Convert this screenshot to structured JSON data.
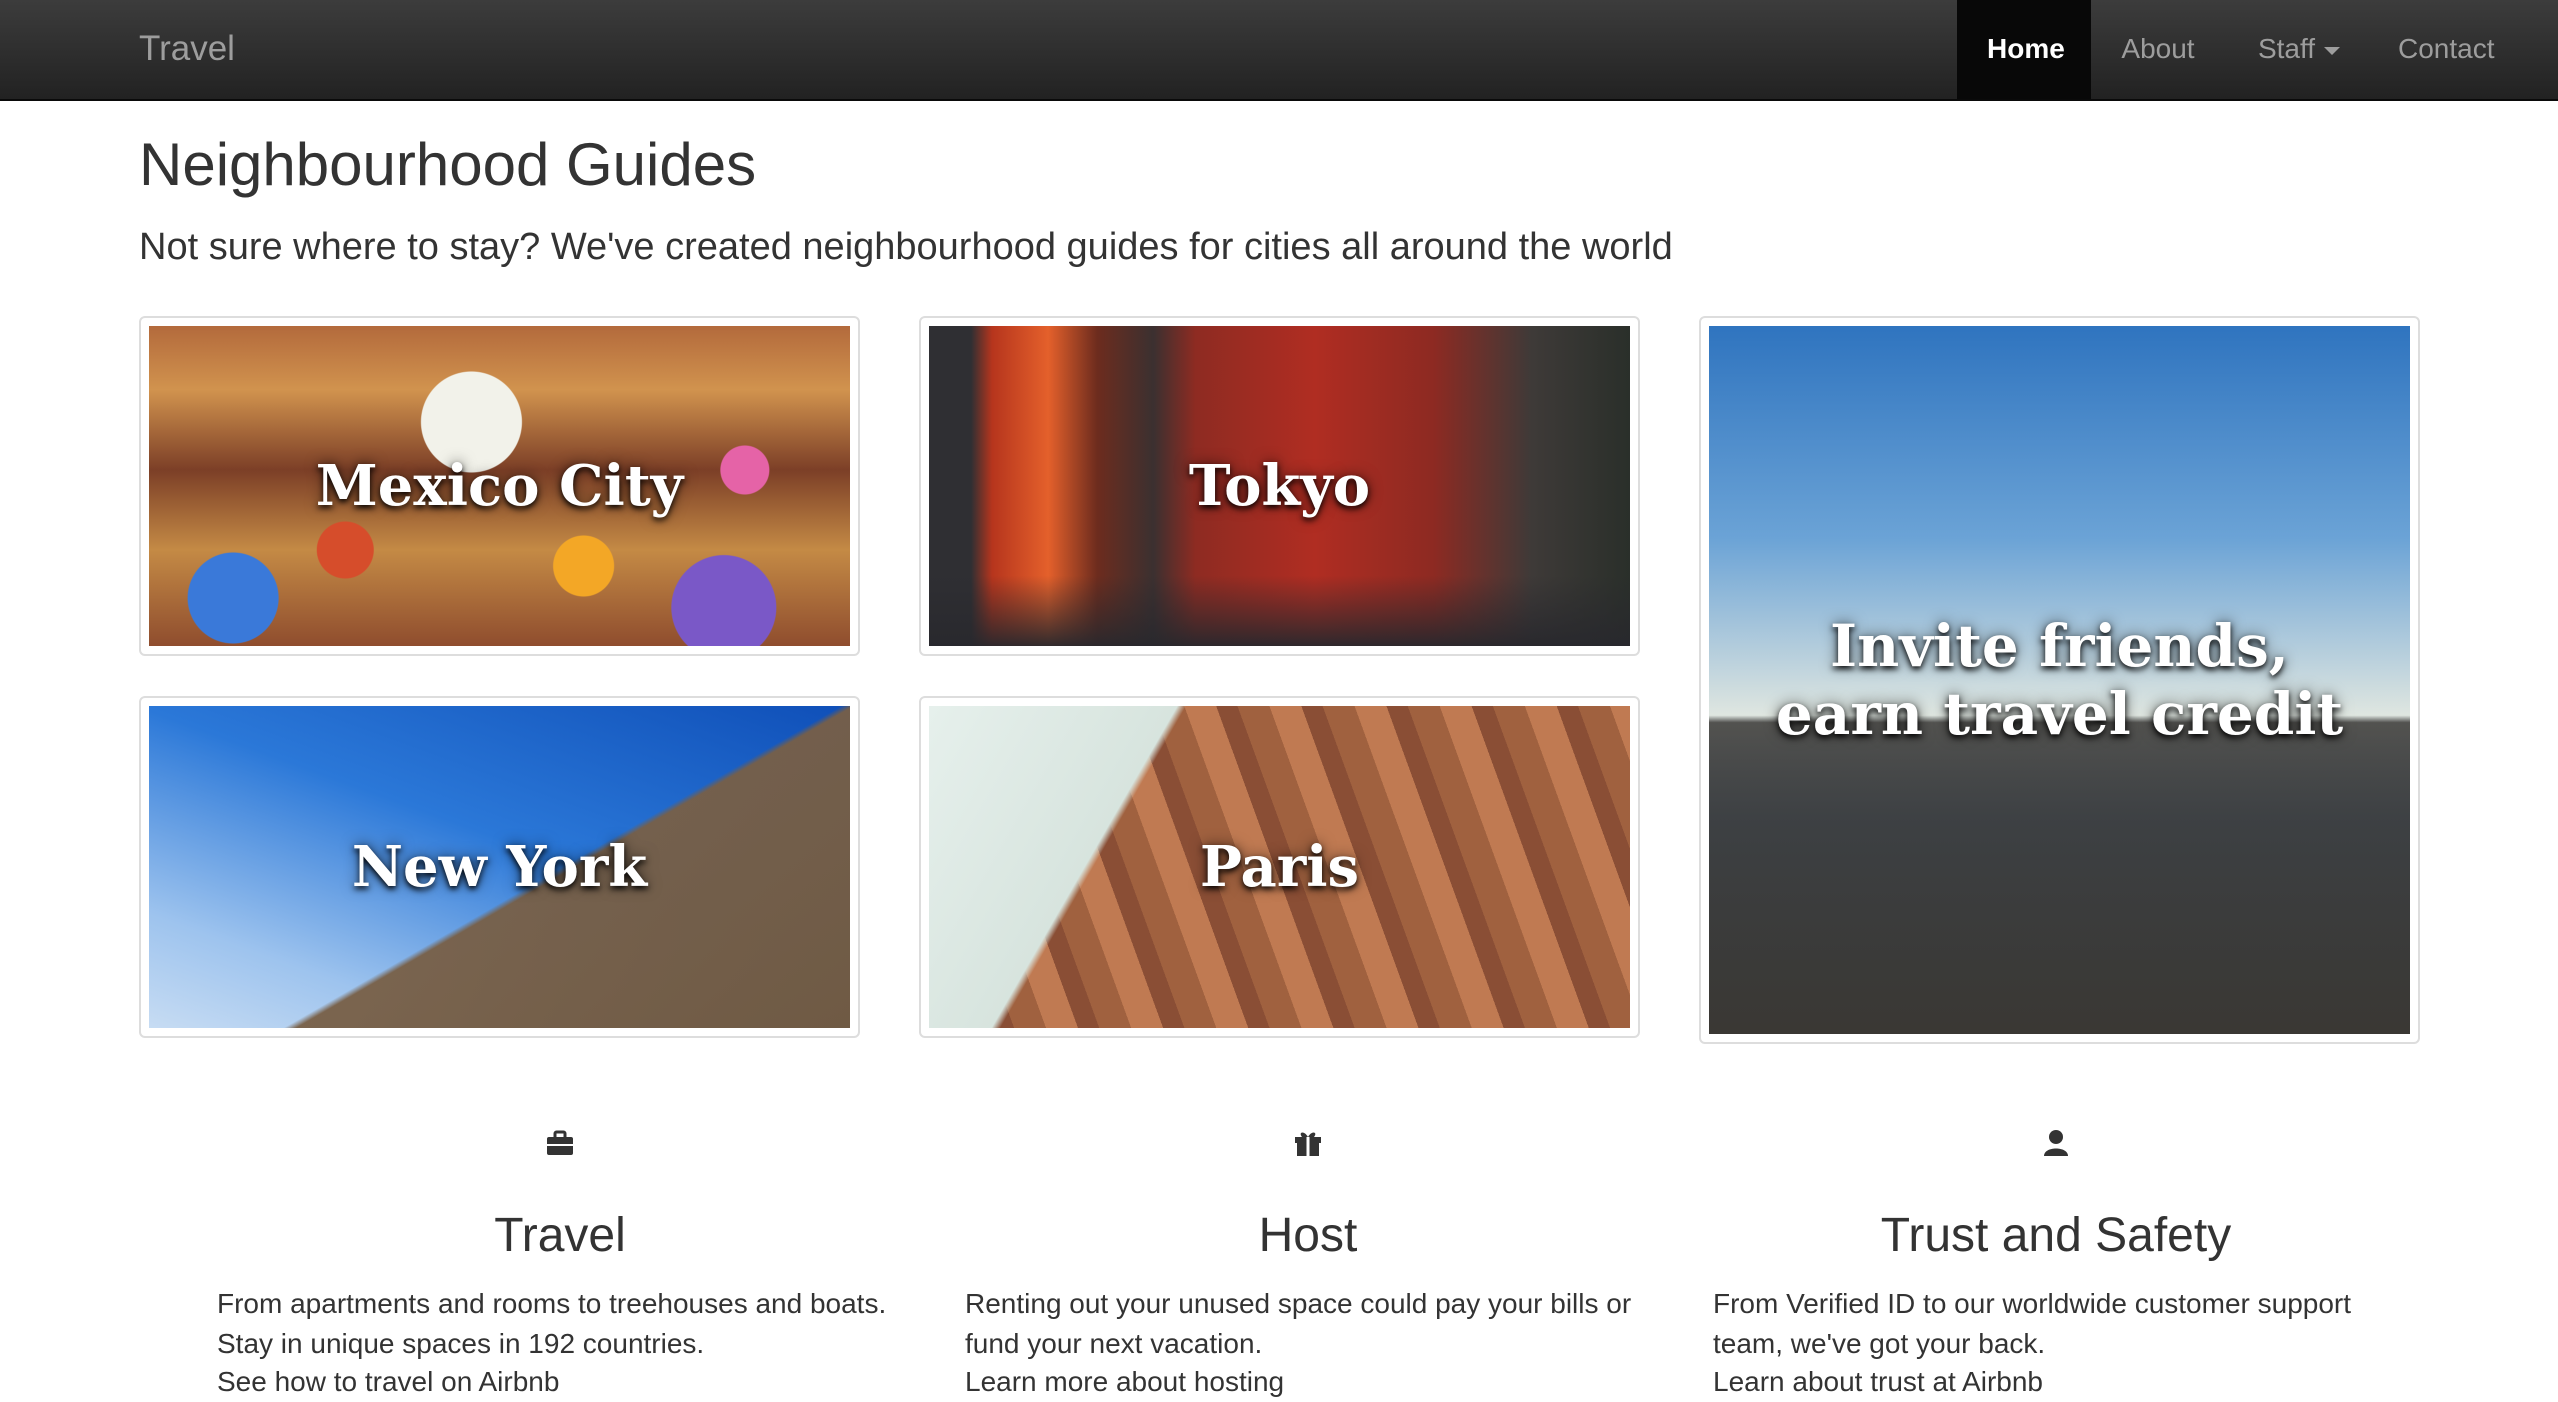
{
  "navbar": {
    "brand": "Travel",
    "items": [
      {
        "label": "Home"
      },
      {
        "label": "About"
      },
      {
        "label": "Staff"
      },
      {
        "label": "Contact"
      }
    ]
  },
  "header": {
    "title": "Neighbourhood Guides",
    "lead": "Not sure where to stay? We've created neighbourhood guides for cities all around the world"
  },
  "guides": [
    {
      "caption": "Mexico City"
    },
    {
      "caption": "Tokyo"
    },
    {
      "caption": "New York"
    },
    {
      "caption": "Paris"
    }
  ],
  "promo": {
    "line1": "Invite friends,",
    "line2": "earn travel credit"
  },
  "features": [
    {
      "icon": "briefcase-icon",
      "title": "Travel",
      "text": "From apartments and rooms to treehouses and boats. Stay in unique spaces in 192 countries.",
      "more": "See how to travel on Airbnb"
    },
    {
      "icon": "gift-icon",
      "title": "Host",
      "text": "Renting out your unused space could pay your bills or fund your next vacation.",
      "more": "Learn more about hosting"
    },
    {
      "icon": "user-icon",
      "title": "Trust and Safety",
      "text": "From Verified ID to our worldwide customer support team, we've got your back.",
      "more": "Learn about trust at Airbnb"
    }
  ]
}
